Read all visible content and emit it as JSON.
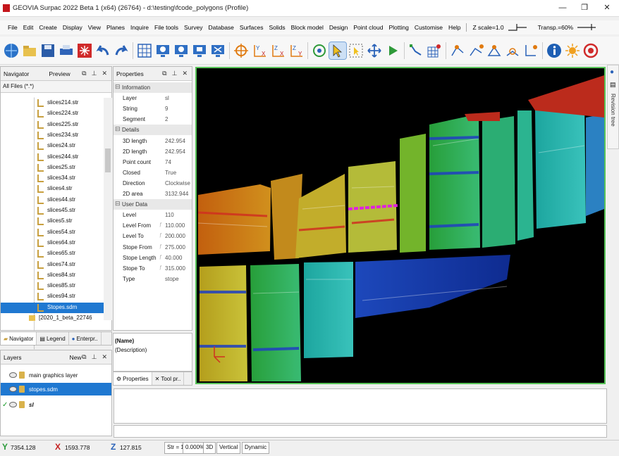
{
  "window": {
    "title": "GEOVIA Surpac 2022 Beta 1 (x64) (26764) - d:\\testing\\fcode_polygons (Profile)",
    "minimize": "—",
    "maximize": "❐",
    "close": "✕"
  },
  "menu": {
    "items": [
      "File",
      "Edit",
      "Create",
      "Display",
      "View",
      "Planes",
      "Inquire",
      "File tools",
      "Survey",
      "Database",
      "Surfaces",
      "Solids",
      "Block model",
      "Design",
      "Point cloud",
      "Plotting",
      "Customise",
      "Help"
    ],
    "zscale": "Z scale=1.0",
    "transp": "Transp.=60%"
  },
  "navigator": {
    "title": "Navigator",
    "preview": "Preview",
    "filter": "All Files (*.*)",
    "files": [
      "slices214.str",
      "slices224.str",
      "slices225.str",
      "slices234.str",
      "slices24.str",
      "slices244.str",
      "slices25.str",
      "slices34.str",
      "slices4.str",
      "slices44.str",
      "slices45.str",
      "slices5.str",
      "slices54.str",
      "slices64.str",
      "slices65.str",
      "slices74.str",
      "slices84.str",
      "slices85.str",
      "slices94.str",
      "Stopes.sdm"
    ],
    "folder_partial": "[2020_1_beta_22746",
    "tabs": [
      "Navigator",
      "Legend",
      "Enterpr.."
    ]
  },
  "layers": {
    "title": "Layers",
    "new": "New",
    "items": [
      "main graphics layer",
      "stopes.sdm",
      "sl"
    ]
  },
  "properties": {
    "title": "Properties",
    "sections": [
      {
        "name": "Information",
        "rows": [
          [
            "Layer",
            "sl"
          ],
          [
            "String",
            "9"
          ],
          [
            "Segment",
            "2"
          ]
        ]
      },
      {
        "name": "Details",
        "rows": [
          [
            "3D length",
            "242.954"
          ],
          [
            "2D length",
            "242.954"
          ],
          [
            "Point count",
            "74"
          ],
          [
            "Closed",
            "True"
          ],
          [
            "Direction",
            "Clockwise"
          ],
          [
            "2D area",
            "3132.944"
          ]
        ]
      },
      {
        "name": "User Data",
        "rows": [
          [
            "Level",
            "110"
          ],
          [
            "Level From",
            "110.000"
          ],
          [
            "Level To",
            "200.000"
          ],
          [
            "Stope From",
            "275.000"
          ],
          [
            "Stope Length",
            "40.000"
          ],
          [
            "Stope To",
            "315.000"
          ],
          [
            "Type",
            "stope"
          ]
        ]
      }
    ],
    "name_label": "(Name)",
    "desc_label": "(Description)",
    "tabs": [
      "Properties",
      "Tool pr.."
    ]
  },
  "side_strip": {
    "label": "Revision tree"
  },
  "status": {
    "y_label": "Y",
    "y_value": "7354.128",
    "x_label": "X",
    "x_value": "1593.778",
    "z_label": "Z",
    "z_value": "127.815",
    "str": "Str = 1",
    "pct": "0.000%",
    "mode3d": "3D",
    "vertical": "Vertical",
    "dynamic": "Dynamic"
  },
  "colors": {
    "viewport_border": "#58c458",
    "selection": "#1f78d1"
  }
}
